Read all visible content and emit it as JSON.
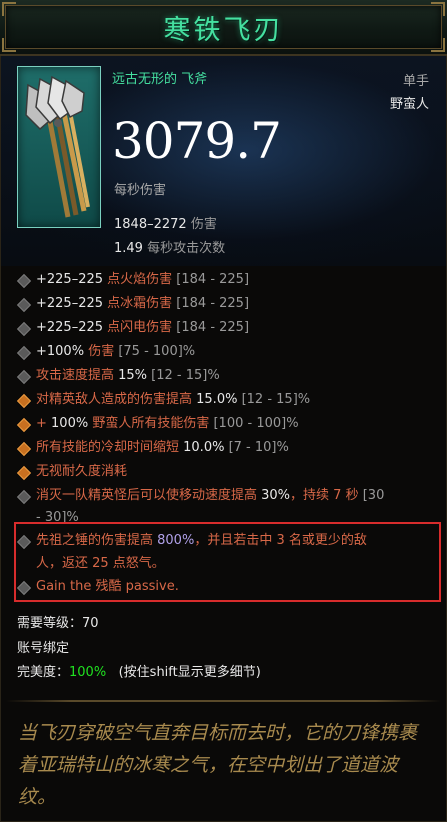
{
  "item": {
    "name": "寒铁飞刃",
    "type": "远古无形的 飞斧",
    "slot": "单手",
    "class": "野蛮人",
    "dps": "3079.7",
    "dps_label": "每秒伤害",
    "damage_range": "1848–2272",
    "damage_label": "伤害",
    "attack_speed": "1.49",
    "attack_speed_label": "每秒攻击次数"
  },
  "affixes": [
    {
      "parts": [
        {
          "t": "+225–225",
          "c": "w"
        },
        {
          "t": " 点火焰伤害",
          "c": "r"
        },
        {
          "t": " [184 - 225]",
          "c": "g"
        }
      ],
      "diamond": "gray"
    },
    {
      "parts": [
        {
          "t": "+225–225",
          "c": "w"
        },
        {
          "t": " 点冰霜伤害",
          "c": "r"
        },
        {
          "t": " [184 - 225]",
          "c": "g"
        }
      ],
      "diamond": "gray"
    },
    {
      "parts": [
        {
          "t": "+225–225",
          "c": "w"
        },
        {
          "t": " 点闪电伤害",
          "c": "r"
        },
        {
          "t": " [184 - 225]",
          "c": "g"
        }
      ],
      "diamond": "gray"
    },
    {
      "parts": [
        {
          "t": "+100%",
          "c": "w"
        },
        {
          "t": " 伤害",
          "c": "r"
        },
        {
          "t": " [75 - 100]%",
          "c": "g"
        }
      ],
      "diamond": "gray"
    },
    {
      "parts": [
        {
          "t": "攻击速度提高 ",
          "c": "r"
        },
        {
          "t": "15%",
          "c": "w"
        },
        {
          "t": " [12 - 15]%",
          "c": "g"
        }
      ],
      "diamond": "gray"
    },
    {
      "parts": [
        {
          "t": "对精英敌人造成的伤害提高 ",
          "c": "r"
        },
        {
          "t": "15.0%",
          "c": "w"
        },
        {
          "t": " [12 - 15]%",
          "c": "g"
        }
      ],
      "diamond": "orange"
    },
    {
      "parts": [
        {
          "t": "+ ",
          "c": "r"
        },
        {
          "t": "100%",
          "c": "w"
        },
        {
          "t": " 野蛮人所有技能伤害",
          "c": "r"
        },
        {
          "t": " [100 - 100]%",
          "c": "g"
        }
      ],
      "diamond": "orange"
    },
    {
      "parts": [
        {
          "t": "所有技能的冷却时间缩短 ",
          "c": "r"
        },
        {
          "t": "10.0%",
          "c": "w"
        },
        {
          "t": " [7 - 10]%",
          "c": "g"
        }
      ],
      "diamond": "orange"
    },
    {
      "parts": [
        {
          "t": "无视耐久度消耗",
          "c": "r"
        }
      ],
      "diamond": "orange"
    },
    {
      "parts": [
        {
          "t": "消灭一队精英怪后可以使移动速度提高 ",
          "c": "r"
        },
        {
          "t": "30%",
          "c": "w"
        },
        {
          "t": "，持续 7 秒",
          "c": "r"
        },
        {
          "t": " [30",
          "c": "g"
        }
      ],
      "diamond": "gray"
    },
    {
      "parts": [
        {
          "t": "- 30]%",
          "c": "g"
        }
      ],
      "diamond": "none"
    },
    {
      "parts": [
        {
          "t": "先祖之锤的伤害提高 ",
          "c": "r"
        },
        {
          "t": "800%",
          "c": "p"
        },
        {
          "t": "，并且若击中 3 名或更少的敌",
          "c": "r"
        }
      ],
      "diamond": "gray"
    },
    {
      "parts": [
        {
          "t": "人，返还 25 点怒气。",
          "c": "r"
        }
      ],
      "diamond": "none"
    },
    {
      "parts": [
        {
          "t": "Gain the 残酷 passive.",
          "c": "r"
        }
      ],
      "diamond": "gray"
    }
  ],
  "footer": {
    "level_label": "需要等级：",
    "level": "70",
    "bound": "账号绑定",
    "perfection_label": "完美度：",
    "perfection": "100%",
    "hint": "(按住shift显示更多细节)"
  },
  "flavor_text": "当飞刃穿破空气直奔目标而去时，它的刀锋携裹着亚瑞特山的冰寒之气，在空中划出了道道波纹。",
  "colors": {
    "title": "#45e0a0",
    "affix_text": "#d86848",
    "highlight_box": "#d82c2c",
    "perfection": "#20e020",
    "flavor": "#a88a4e"
  },
  "icons": [
    "throwing-axe-icon",
    "affix-diamond-icon"
  ]
}
